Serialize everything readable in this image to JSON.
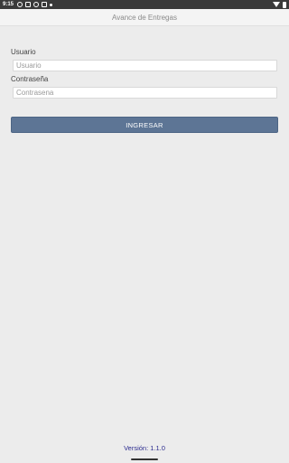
{
  "status_bar": {
    "time": "9:15",
    "left_icons": [
      "notification-icon",
      "image-icon",
      "sync-icon",
      "data-icon",
      "dot-icon"
    ],
    "right_icons": [
      "wifi-icon",
      "battery-icon"
    ]
  },
  "app_bar": {
    "title": "Avance de Entregas"
  },
  "login_form": {
    "username_label": "Usuario",
    "username_placeholder": "Usuario",
    "username_value": "",
    "password_label": "Contraseña",
    "password_placeholder": "Contrasena",
    "password_value": "",
    "submit_label": "INGRESAR"
  },
  "footer": {
    "version": "Versión: 1.1.0"
  },
  "colors": {
    "background": "#ececec",
    "button": "#5d7595",
    "version_text": "#2d2d8f"
  }
}
